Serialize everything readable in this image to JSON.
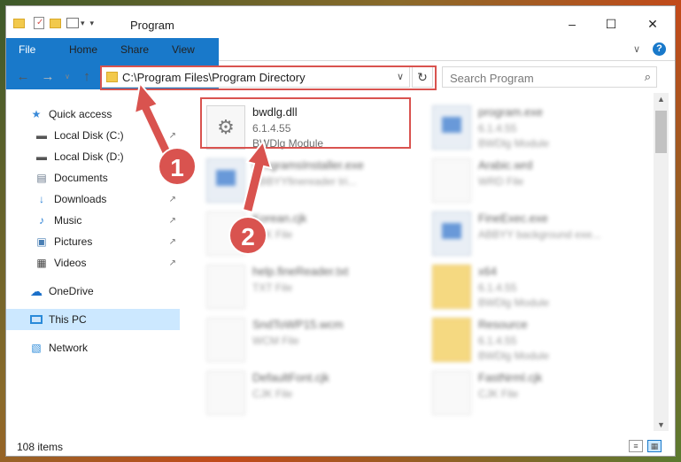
{
  "window": {
    "title": "Program",
    "minimize_glyph": "–",
    "maximize_glyph": "☐",
    "close_glyph": "✕"
  },
  "ribbon": {
    "tabs": [
      "File",
      "Home",
      "Share",
      "View"
    ],
    "expand_glyph": "∨",
    "help_glyph": "?"
  },
  "address": {
    "path": "C:\\Program Files\\Program Directory",
    "dropdown_glyph": "∨",
    "refresh_glyph": "↻"
  },
  "search": {
    "placeholder": "Search Program",
    "icon_glyph": "⌕"
  },
  "sidebar": {
    "items": [
      {
        "label": "Quick access",
        "icon": "star-icon",
        "glyph": "★",
        "color": "#3a8ad9",
        "pinned": false
      },
      {
        "label": "Local Disk (C:)",
        "icon": "drive-icon",
        "glyph": "▬",
        "color": "#555555",
        "pinned": true
      },
      {
        "label": "Local Disk (D:)",
        "icon": "drive-icon",
        "glyph": "▬",
        "color": "#555555",
        "pinned": false
      },
      {
        "label": "Documents",
        "icon": "documents-icon",
        "glyph": "▤",
        "color": "#6a7a8c",
        "pinned": true
      },
      {
        "label": "Downloads",
        "icon": "download-icon",
        "glyph": "↓",
        "color": "#2a7fd4",
        "pinned": true
      },
      {
        "label": "Music",
        "icon": "music-icon",
        "glyph": "♪",
        "color": "#2a7fd4",
        "pinned": true
      },
      {
        "label": "Pictures",
        "icon": "pictures-icon",
        "glyph": "▣",
        "color": "#4a7fb4",
        "pinned": true
      },
      {
        "label": "Videos",
        "icon": "videos-icon",
        "glyph": "▦",
        "color": "#444444",
        "pinned": true
      },
      {
        "label": "OneDrive",
        "icon": "cloud-icon",
        "glyph": "☁",
        "color": "#1a6fc9",
        "pinned": false
      },
      {
        "label": "This PC",
        "icon": "computer-icon",
        "glyph": "▭",
        "color": "#2a8ad9",
        "pinned": false,
        "selected": true
      },
      {
        "label": "Network",
        "icon": "network-icon",
        "glyph": "▧",
        "color": "#2a8ad9",
        "pinned": false
      }
    ],
    "pin_glyph": "↗"
  },
  "files": [
    {
      "name": "bwdlg.dll",
      "line1": "6.1.4.55",
      "line2": "BWDlg Module",
      "kind": "dll",
      "highlighted": true
    },
    {
      "name": "program.exe",
      "line1": "6.1.4.55",
      "line2": "BWDlg Module",
      "kind": "exe"
    },
    {
      "name": "ProgramsInstaller.exe",
      "line1": "ABBYYfinereader tri...",
      "line2": "",
      "kind": "exe"
    },
    {
      "name": "Arabic.wrd",
      "line1": "WRD File",
      "line2": "",
      "kind": "doc"
    },
    {
      "name": "Korean.cjk",
      "line1": "CJK File",
      "line2": "",
      "kind": "doc"
    },
    {
      "name": "FineExec.exe",
      "line1": "ABBYY background exe...",
      "line2": "",
      "kind": "exe"
    },
    {
      "name": "help.fineReader.txt",
      "line1": "TXT File",
      "line2": "",
      "kind": "doc"
    },
    {
      "name": "x64",
      "line1": "6.1.4.55",
      "line2": "BWDlg Module",
      "kind": "folder"
    },
    {
      "name": "SndToWP15.wcm",
      "line1": "WCM File",
      "line2": "",
      "kind": "doc"
    },
    {
      "name": "Resource",
      "line1": "6.1.4.55",
      "line2": "BWDlg Module",
      "kind": "folder"
    },
    {
      "name": "DefaultFont.cjk",
      "line1": "CJK File",
      "line2": "",
      "kind": "doc"
    },
    {
      "name": "FastNrml.cjk",
      "line1": "CJK File",
      "line2": "",
      "kind": "doc"
    }
  ],
  "status": {
    "item_count": "108 items"
  },
  "annotations": [
    {
      "number": "1"
    },
    {
      "number": "2"
    }
  ],
  "colors": {
    "accent": "#1979ca",
    "highlight_box": "#d9534f",
    "selection": "#cce8ff"
  }
}
